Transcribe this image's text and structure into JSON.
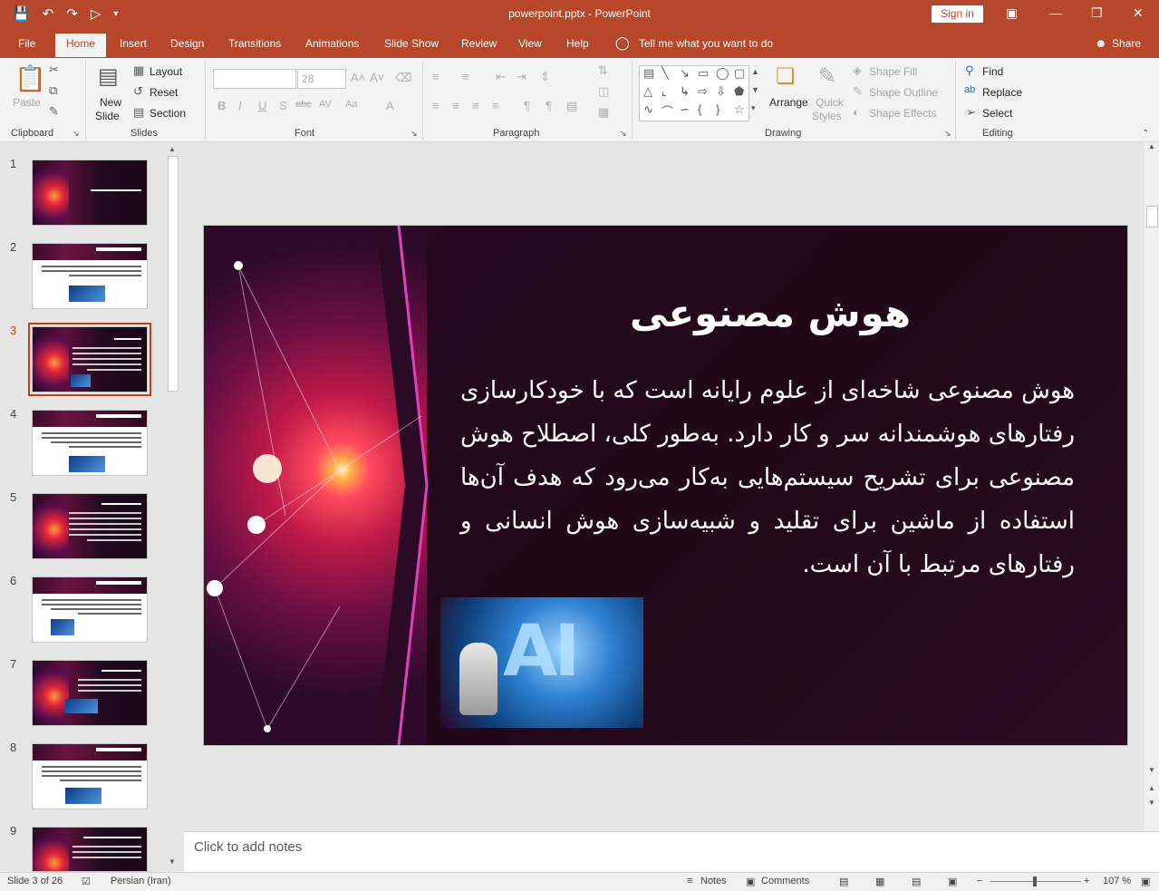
{
  "window": {
    "title": "powerpoint.pptx  -  PowerPoint",
    "signin_label": "Sign in"
  },
  "tabs": [
    "File",
    "Home",
    "Insert",
    "Design",
    "Transitions",
    "Animations",
    "Slide Show",
    "Review",
    "View",
    "Help"
  ],
  "active_tab": "Home",
  "tell_me": "Tell me what you want to do",
  "share_label": "Share",
  "ribbon": {
    "clipboard": {
      "label": "Clipboard",
      "paste": "Paste"
    },
    "slides": {
      "label": "Slides",
      "new_slide_1": "New",
      "new_slide_2": "Slide",
      "layout": "Layout",
      "reset": "Reset",
      "section": "Section"
    },
    "font": {
      "label": "Font",
      "font_name": "",
      "font_size": "28"
    },
    "paragraph": {
      "label": "Paragraph"
    },
    "drawing": {
      "label": "Drawing",
      "arrange": "Arrange",
      "quick_styles_1": "Quick",
      "quick_styles_2": "Styles",
      "shape_fill": "Shape Fill",
      "shape_outline": "Shape Outline",
      "shape_effects": "Shape Effects"
    },
    "editing": {
      "label": "Editing",
      "find": "Find",
      "replace": "Replace",
      "select": "Select"
    }
  },
  "thumbnails": [
    {
      "num": "1",
      "style": "dark"
    },
    {
      "num": "2",
      "style": "light"
    },
    {
      "num": "3",
      "style": "dark",
      "selected": true
    },
    {
      "num": "4",
      "style": "light"
    },
    {
      "num": "5",
      "style": "dark"
    },
    {
      "num": "6",
      "style": "light"
    },
    {
      "num": "7",
      "style": "dark"
    },
    {
      "num": "8",
      "style": "light"
    },
    {
      "num": "9",
      "style": "dark"
    }
  ],
  "slide": {
    "title": "هوش مصنوعی",
    "body": "هوش مصنوعی شاخه‌ای از علوم رایانه است که با خودکارسازی رفتارهای هوشمندانه سر و کار دارد. به‌طور کلی، اصطلاح هوش مصنوعی برای تشریح سیستم‌هایی به‌کار می‌رود که هدف آن‌ها استفاده از ماشین برای تقلید و شبیه‌سازی هوش انسانی و رفتارهای مرتبط با آن است.",
    "image_text": "AI"
  },
  "notes_placeholder": "Click to add notes",
  "status": {
    "slide_info": "Slide 3 of 26",
    "language": "Persian (Iran)",
    "notes": "Notes",
    "comments": "Comments",
    "zoom": "107 %"
  },
  "colors": {
    "accent": "#b7472a",
    "selected_thumb": "#c43e1c"
  }
}
